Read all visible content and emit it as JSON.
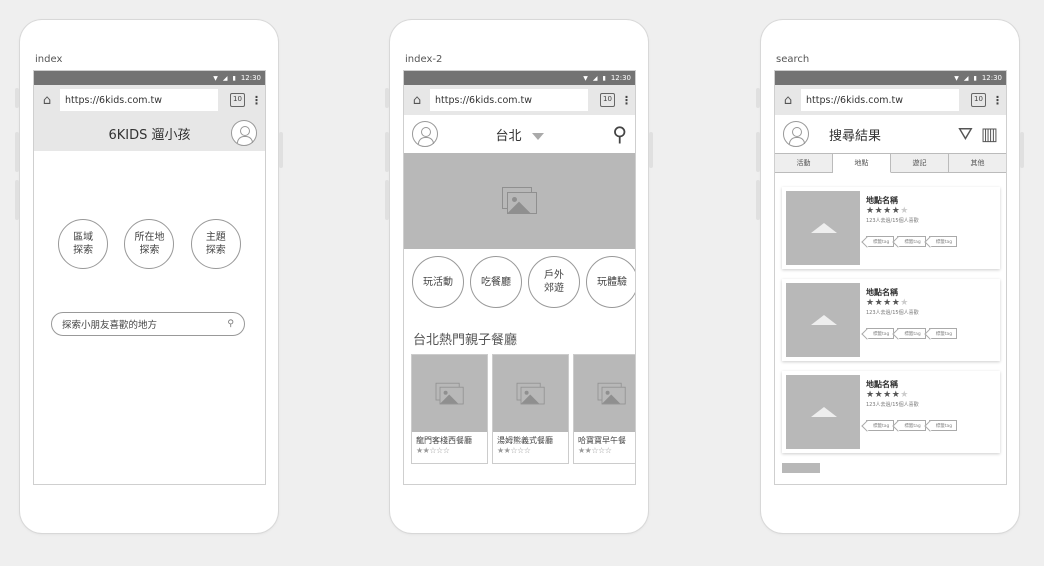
{
  "common": {
    "url": "https://6kids.com.tw",
    "tab_count": "10",
    "status_time": "12:30"
  },
  "screen1": {
    "label": "index",
    "header_title": "6KIDS 遛小孩",
    "explore_buttons": [
      "區域\n探索",
      "所在地\n探索",
      "主題\n探索"
    ],
    "search_placeholder": "探索小朋友喜歡的地方"
  },
  "screen2": {
    "label": "index-2",
    "city": "台北",
    "categories": [
      "玩活動",
      "吃餐廳",
      "戶外\n郊遊",
      "玩體驗"
    ],
    "section_title": "台北熱門親子餐廳",
    "restaurants": [
      {
        "name": "龍門客棧西餐廳",
        "stars": "★★☆☆☆"
      },
      {
        "name": "湯姆熊義式餐廳",
        "stars": "★★☆☆☆"
      },
      {
        "name": "哈寶寶早午餐",
        "stars": "★★☆☆☆"
      }
    ]
  },
  "screen3": {
    "label": "search",
    "title": "搜尋結果",
    "tabs": [
      "活動",
      "地點",
      "遊記",
      "其他"
    ],
    "active_tab": 1,
    "results": [
      {
        "name": "地點名稱",
        "stars_on": "★★★★",
        "stars_off": "★",
        "meta": "123人去過/15個人喜歡",
        "tags": [
          "標籤tag",
          "標籤tag",
          "標籤tag"
        ]
      },
      {
        "name": "地點名稱",
        "stars_on": "★★★★",
        "stars_off": "★",
        "meta": "123人去過/15個人喜歡",
        "tags": [
          "標籤tag",
          "標籤tag",
          "標籤tag"
        ]
      },
      {
        "name": "地點名稱",
        "stars_on": "★★★★",
        "stars_off": "★",
        "meta": "123人去過/15個人喜歡",
        "tags": [
          "標籤tag",
          "標籤tag",
          "標籤tag"
        ]
      }
    ]
  }
}
